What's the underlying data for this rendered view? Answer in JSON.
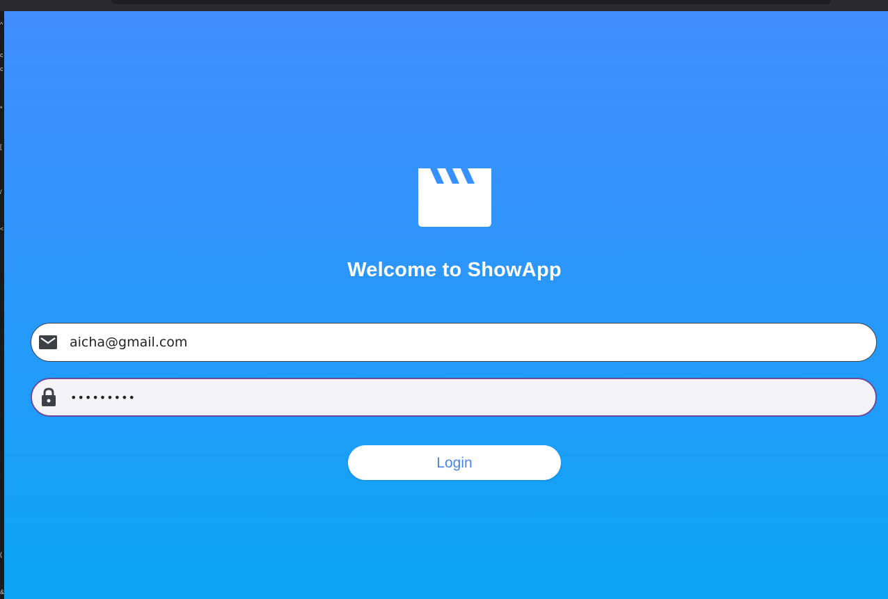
{
  "app": {
    "title": "Welcome to ShowApp",
    "logo_icon": "movie-clapperboard-icon",
    "background_top": "#418cff",
    "background_bottom": "#0ba5f3"
  },
  "form": {
    "email": {
      "icon": "mail-icon",
      "value": "aicha@gmail.com"
    },
    "password": {
      "icon": "lock-icon",
      "value": "•••••••••"
    },
    "login_label": "Login",
    "login_text_color": "#4a86e8"
  }
}
